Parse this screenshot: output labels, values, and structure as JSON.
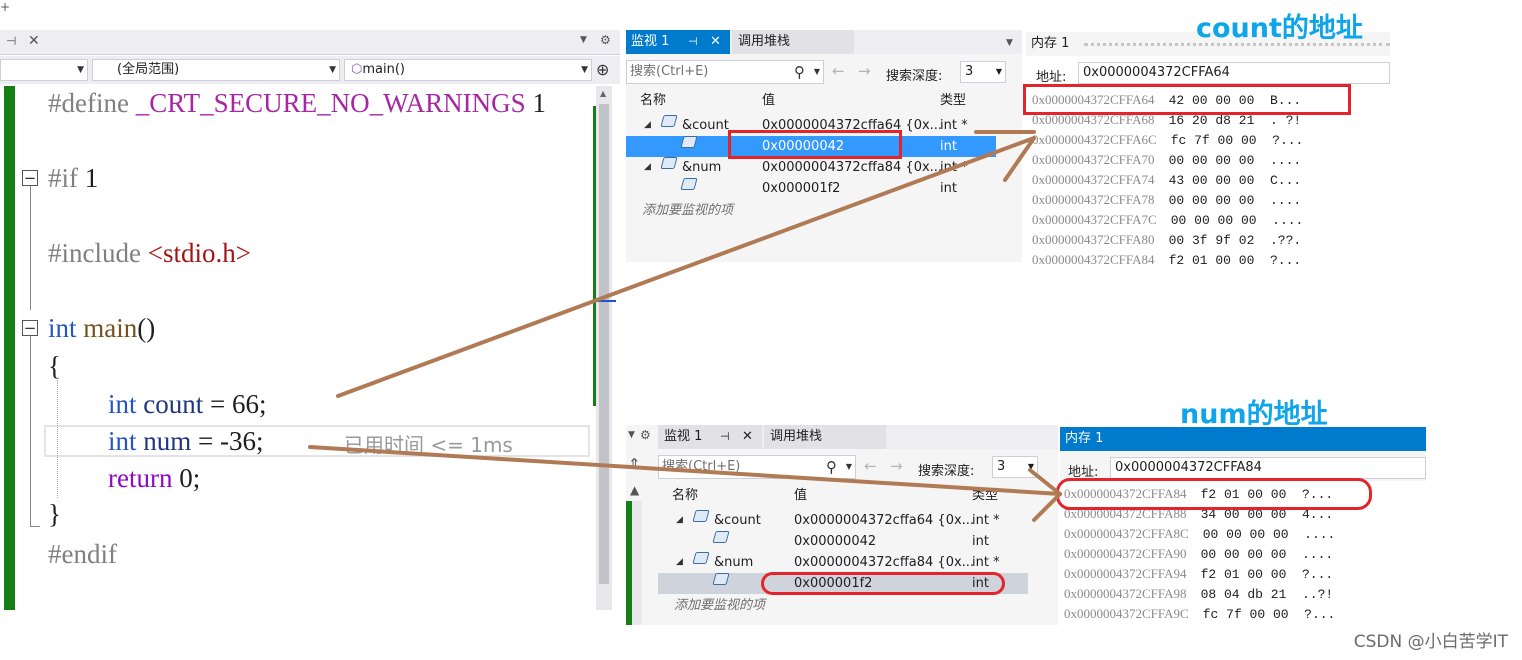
{
  "editor": {
    "scope_combo": "(全局范围)",
    "func_combo": "main()",
    "lines": {
      "l1_pp": "#define ",
      "l1_macro": "_CRT_SECURE_NO_WARNINGS",
      "l1_val": " 1",
      "l2_pp": "#if ",
      "l2_val": "1",
      "l3_pp": "#include ",
      "l3_str": "<stdio.h>",
      "l4_kw": "int",
      "l4_fn": " main",
      "l4_rest": "()",
      "l5": "{",
      "l6_kw": "int",
      "l6_var": " count",
      "l6_rest": " = 66;",
      "l7_kw": "int",
      "l7_var": " num",
      "l7_rest": " = -36;",
      "l8_kw": "return",
      "l8_rest": " 0;",
      "l9": "}",
      "l10_pp": "#endif"
    },
    "perf_tip": "已用时间 <= 1ms"
  },
  "watch_top": {
    "tab_watch": "监视 1",
    "tab_callstack": "调用堆栈",
    "search_placeholder": "搜索(Ctrl+E)",
    "depth_label": "搜索深度:",
    "depth_value": "3",
    "col_name": "名称",
    "col_value": "值",
    "col_type": "类型",
    "rows": [
      {
        "name": "&count",
        "value": "0x0000004372cffa64 {0x...",
        "type": "int *"
      },
      {
        "name": "",
        "value": "0x00000042",
        "type": "int"
      },
      {
        "name": "&num",
        "value": "0x0000004372cffa84 {0x...",
        "type": "int *"
      },
      {
        "name": "",
        "value": "0x000001f2",
        "type": "int"
      }
    ],
    "add_hint": "添加要监视的项"
  },
  "memory_top": {
    "title": "内存 1",
    "addr_label": "地址:",
    "addr_value": "0x0000004372CFFA64",
    "rows": [
      {
        "addr": "0x0000004372CFFA64",
        "bytes": "42 00 00 00  B..."
      },
      {
        "addr": "0x0000004372CFFA68",
        "bytes": "16 20 d8 21  . ?!"
      },
      {
        "addr": "0x0000004372CFFA6C",
        "bytes": "fc 7f 00 00  ?..."
      },
      {
        "addr": "0x0000004372CFFA70",
        "bytes": "00 00 00 00  ...."
      },
      {
        "addr": "0x0000004372CFFA74",
        "bytes": "43 00 00 00  C..."
      },
      {
        "addr": "0x0000004372CFFA78",
        "bytes": "00 00 00 00  ...."
      },
      {
        "addr": "0x0000004372CFFA7C",
        "bytes": "00 00 00 00  ...."
      },
      {
        "addr": "0x0000004372CFFA80",
        "bytes": "00 3f 9f 02  .??."
      },
      {
        "addr": "0x0000004372CFFA84",
        "bytes": "f2 01 00 00  ?..."
      }
    ]
  },
  "watch_bottom": {
    "tab_watch": "监视 1",
    "tab_callstack": "调用堆栈",
    "search_placeholder": "搜索(Ctrl+E)",
    "depth_label": "搜索深度:",
    "depth_value": "3",
    "col_name": "名称",
    "col_value": "值",
    "col_type": "类型",
    "rows": [
      {
        "name": "&count",
        "value": "0x0000004372cffa64 {0x...",
        "type": "int *"
      },
      {
        "name": "",
        "value": "0x00000042",
        "type": "int"
      },
      {
        "name": "&num",
        "value": "0x0000004372cffa84 {0x...",
        "type": "int *"
      },
      {
        "name": "",
        "value": "0x000001f2",
        "type": "int"
      }
    ],
    "add_hint": "添加要监视的项"
  },
  "memory_bottom": {
    "title": "内存 1",
    "addr_label": "地址:",
    "addr_value": "0x0000004372CFFA84",
    "rows": [
      {
        "addr": "0x0000004372CFFA84",
        "bytes": "f2 01 00 00  ?..."
      },
      {
        "addr": "0x0000004372CFFA88",
        "bytes": "34 00 00 00  4..."
      },
      {
        "addr": "0x0000004372CFFA8C",
        "bytes": "00 00 00 00  ...."
      },
      {
        "addr": "0x0000004372CFFA90",
        "bytes": "00 00 00 00  ...."
      },
      {
        "addr": "0x0000004372CFFA94",
        "bytes": "f2 01 00 00  ?..."
      },
      {
        "addr": "0x0000004372CFFA98",
        "bytes": "08 04 db 21  ..?!"
      },
      {
        "addr": "0x0000004372CFFA9C",
        "bytes": "fc 7f 00 00  ?..."
      }
    ]
  },
  "annotations": {
    "count_addr": "count的地址",
    "num_addr": "num的地址",
    "arrow_color": "#b07a55",
    "box_color": "#e3242b"
  },
  "watermark": "CSDN @小白苦学IT",
  "colors": {
    "accent": "#007acc",
    "selection": "#3399ff",
    "gutter": "#157e15",
    "annotation": "#0ea5e9"
  }
}
